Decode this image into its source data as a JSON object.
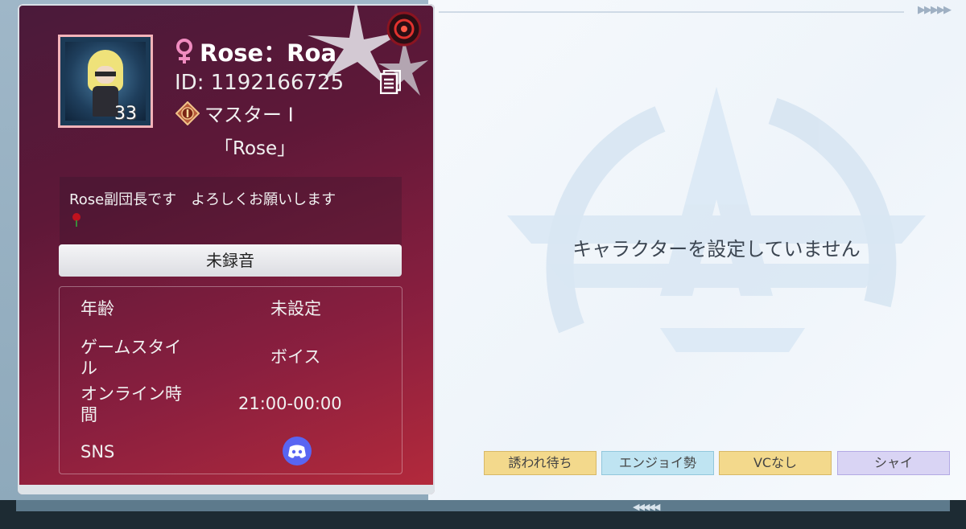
{
  "profile": {
    "name": "Rose：Roa",
    "id_text": "ID: 1192166725",
    "level": "33",
    "rank": "マスター Ⅰ",
    "guild": "「Rose」",
    "comment": "Rose副団長です　よろしくお願いします",
    "voice_label": "未録音"
  },
  "info": [
    {
      "label": "年齢",
      "value": "未設定"
    },
    {
      "label": "ゲームスタイ\nル",
      "value": "ボイス"
    },
    {
      "label": "オンライン時\n間",
      "value": "21:00-00:00"
    },
    {
      "label": "SNS",
      "value": ""
    }
  ],
  "character": {
    "empty_text": "キャラクターを設定していません"
  },
  "tags": [
    "誘われ待ち",
    "エンジョイ勢",
    "VCなし",
    "シャイ"
  ],
  "colors": {
    "card_top": "#4a1a3a",
    "card_bottom": "#b52a3b",
    "female_icon": "#f08cc0",
    "discord": "#5865f2",
    "tag_yellow": "#f3d98c",
    "tag_blue": "#bfe4f2",
    "tag_purple": "#d9d4f4"
  },
  "icons": {
    "gender": "female-icon",
    "copy": "document-icon",
    "rank": "rank-badge-icon",
    "comment": "rose-icon",
    "sns": "discord-icon"
  }
}
